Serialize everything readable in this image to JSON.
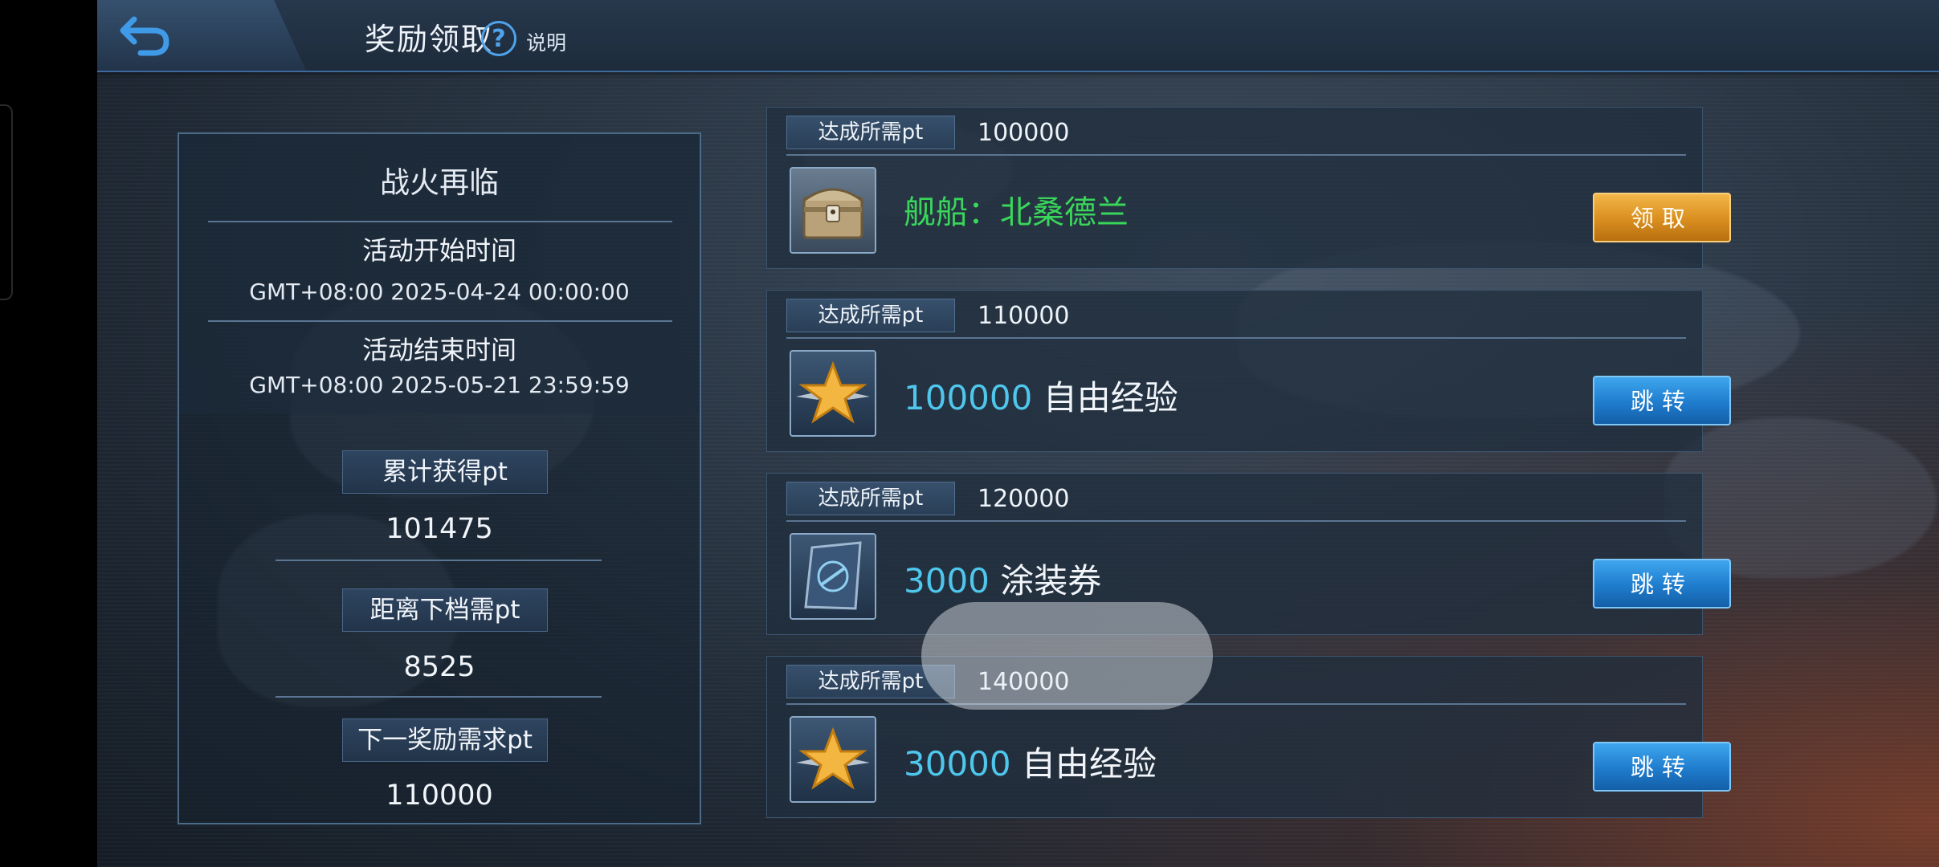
{
  "header": {
    "title": "奖励领取",
    "help_label": "说明"
  },
  "event": {
    "name": "战火再临",
    "start_label": "活动开始时间",
    "start_time": "GMT+08:00 2025-04-24 00:00:00",
    "end_label": "活动结束时间",
    "end_time": "GMT+08:00 2025-05-21 23:59:59"
  },
  "stats": {
    "total_label": "累计获得pt",
    "total_value": "101475",
    "next_gap_label": "距离下档需pt",
    "next_gap_value": "8525",
    "next_req_label": "下一奖励需求pt",
    "next_req_value": "110000"
  },
  "rewards": [
    {
      "req_label": "达成所需pt",
      "req_value": "100000",
      "reward_text": "舰船：北桑德兰",
      "icon": "treasure-chest-icon",
      "button": "领取"
    },
    {
      "req_label": "达成所需pt",
      "req_value": "110000",
      "amount": "100000",
      "name": "自由经验",
      "icon": "star-icon",
      "button": "跳转"
    },
    {
      "req_label": "达成所需pt",
      "req_value": "120000",
      "amount": "3000",
      "name": "涂装券",
      "icon": "camo-ticket-icon",
      "button": "跳转"
    },
    {
      "req_label": "达成所需pt",
      "req_value": "140000",
      "amount": "30000",
      "name": "自由经验",
      "icon": "star-icon",
      "button": "跳转"
    }
  ],
  "colors": {
    "claim_button": "#d98e1f",
    "jump_button": "#1f7ccd",
    "amount_text": "#4fc6ec",
    "ship_text": "#39d65a"
  }
}
